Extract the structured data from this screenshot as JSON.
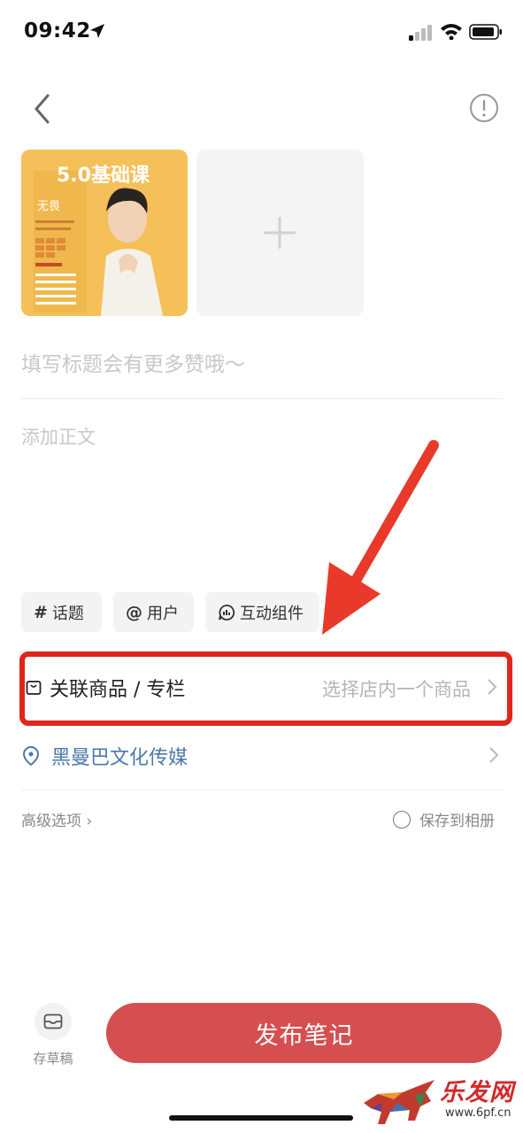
{
  "status_bar": {
    "time": "09:42"
  },
  "images": {
    "poster_text": "5.0基础课",
    "poster_name": "无畏"
  },
  "editor": {
    "title_placeholder": "填写标题会有更多赞哦～",
    "body_placeholder": "添加正文"
  },
  "chips": [
    {
      "icon": "#",
      "label": "话题"
    },
    {
      "icon": "@",
      "label": "用户"
    },
    {
      "icon": "comment-icon",
      "label": "互动组件"
    }
  ],
  "product": {
    "label": "关联商品 / 专栏",
    "value": "选择店内一个商品"
  },
  "location": {
    "label": "黑曼巴文化传媒"
  },
  "options": {
    "advanced": "高级选项",
    "save_album": "保存到相册"
  },
  "bottom": {
    "draft_label": "存草稿",
    "publish_label": "发布笔记"
  },
  "watermark": {
    "text": "乐发网",
    "url": "www.6pf.cn"
  },
  "colors": {
    "publish": "#d64f50",
    "highlight": "#e0251b",
    "location": "#4b79a8"
  }
}
